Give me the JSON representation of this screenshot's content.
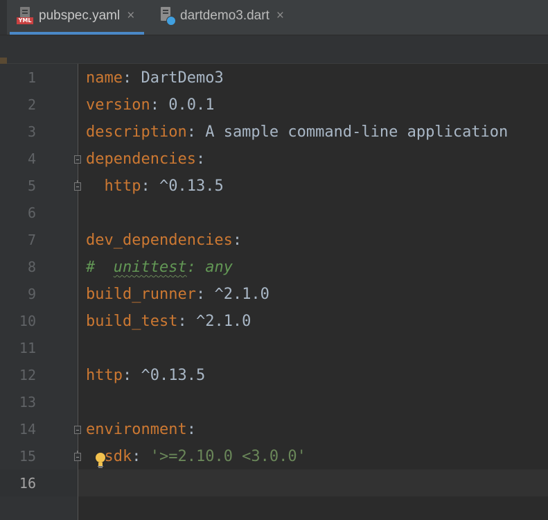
{
  "tabs": [
    {
      "label": "pubspec.yaml",
      "icon": "yaml-file-icon",
      "badge": "YML",
      "active": true,
      "close": "×"
    },
    {
      "label": "dartdemo3.dart",
      "icon": "dart-file-icon",
      "active": false,
      "close": "×"
    }
  ],
  "editor": {
    "current_line": 16,
    "lines": [
      {
        "n": "1",
        "key": "name",
        "sep": ": ",
        "value": "DartDemo3"
      },
      {
        "n": "2",
        "key": "version",
        "sep": ": ",
        "value": "0.0.1"
      },
      {
        "n": "3",
        "key": "description",
        "sep": ": ",
        "value": "A sample command-line application"
      },
      {
        "n": "4",
        "key": "dependencies",
        "sep": ":",
        "value": ""
      },
      {
        "n": "5",
        "key": "  http",
        "sep": ": ",
        "value": "^0.13.5"
      },
      {
        "n": "6"
      },
      {
        "n": "7",
        "key": "dev_dependencies",
        "sep": ":",
        "value": ""
      },
      {
        "n": "8",
        "comment_hash": "#  ",
        "comment_word": "unittest",
        "comment_rest": ": any"
      },
      {
        "n": "9",
        "key": "build_runner",
        "sep": ": ",
        "value": "^2.1.0"
      },
      {
        "n": "10",
        "key": "build_test",
        "sep": ": ",
        "value": "^2.1.0"
      },
      {
        "n": "11"
      },
      {
        "n": "12",
        "key": "http",
        "sep": ": ",
        "value": "^0.13.5"
      },
      {
        "n": "13"
      },
      {
        "n": "14",
        "key": "environment",
        "sep": ":",
        "value": ""
      },
      {
        "n": "15",
        "key": "  sdk",
        "sep": ": ",
        "string": "'>=2.10.0 <3.0.0'"
      },
      {
        "n": "16"
      }
    ]
  },
  "colors": {
    "background": "#2b2b2b",
    "key": "#cc7832",
    "text": "#a9b7c6",
    "string": "#6a8759",
    "comment": "#629755",
    "line_number": "#606366",
    "tab_underline": "#4a88c7"
  }
}
